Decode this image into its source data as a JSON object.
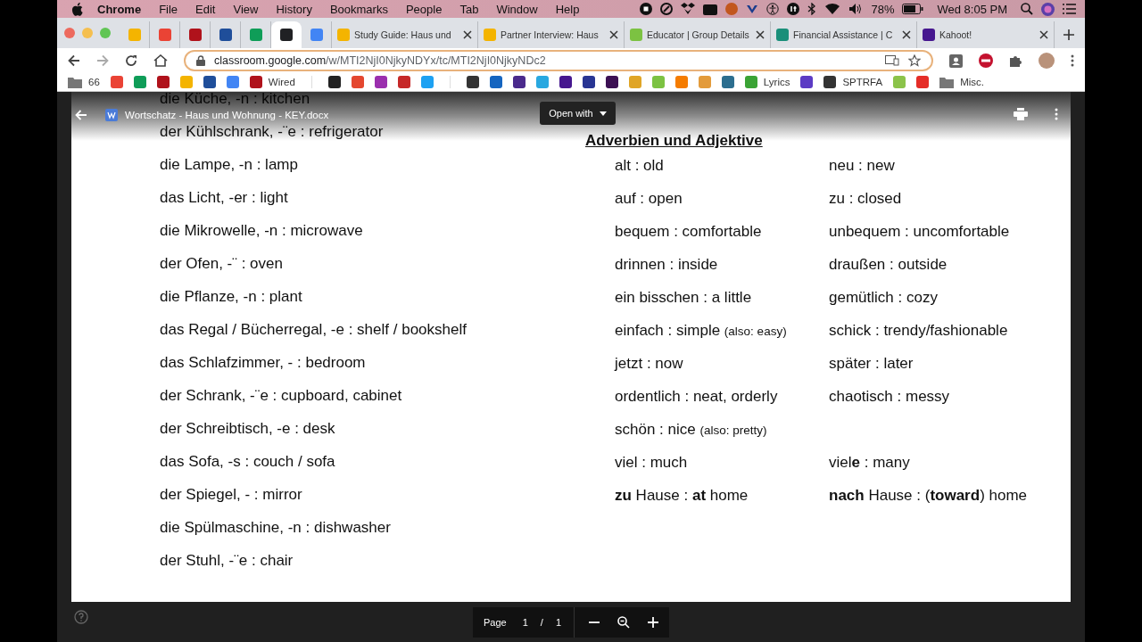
{
  "menu_bar": {
    "app": "Chrome",
    "items": [
      "File",
      "Edit",
      "View",
      "History",
      "Bookmarks",
      "People",
      "Tab",
      "Window",
      "Help"
    ],
    "battery": "78%",
    "clock": "Wed 8:05 PM"
  },
  "tabs": [
    {
      "kind": "pinned",
      "color": "#f4b400",
      "selected": false
    },
    {
      "kind": "pinned",
      "color": "#ea4335",
      "selected": false
    },
    {
      "kind": "pinned",
      "color": "#b0121b",
      "selected": false
    },
    {
      "kind": "pinned",
      "color": "#1f4e9a",
      "selected": false
    },
    {
      "kind": "pinned",
      "color": "#0f9d58",
      "selected": false
    },
    {
      "kind": "pinned",
      "color": "#202124",
      "selected": true
    },
    {
      "kind": "pinned",
      "color": "#4285f4",
      "selected": false
    },
    {
      "kind": "titled",
      "color": "#f4b400",
      "title": "Study Guide: Haus und",
      "selected": false
    },
    {
      "kind": "titled",
      "color": "#f4b400",
      "title": "Partner Interview: Haus",
      "selected": false
    },
    {
      "kind": "titled",
      "color": "#7cc242",
      "title": "Educator | Group Details",
      "selected": false
    },
    {
      "kind": "titled",
      "color": "#1a8f7a",
      "title": "Financial Assistance | C",
      "selected": false
    },
    {
      "kind": "titled",
      "color": "#46178f",
      "title": "Kahoot!",
      "selected": false
    }
  ],
  "address_bar": {
    "host": "classroom.google.com",
    "path": "/w/MTI2NjI0NjkyNDYx/tc/MTI2NjI0NjkyNDc2"
  },
  "bookmarks": [
    {
      "kind": "folder",
      "label": "66"
    },
    {
      "kind": "site",
      "color": "#ea4335"
    },
    {
      "kind": "site",
      "color": "#0f9d58"
    },
    {
      "kind": "site",
      "color": "#b0121b"
    },
    {
      "kind": "site",
      "color": "#f4b400"
    },
    {
      "kind": "site",
      "color": "#1f4e9a"
    },
    {
      "kind": "site",
      "color": "#4285f4"
    },
    {
      "kind": "site",
      "color": "#b0121b",
      "label": "Wired"
    },
    {
      "kind": "separator"
    },
    {
      "kind": "site",
      "color": "#222222"
    },
    {
      "kind": "site",
      "color": "#e4472f"
    },
    {
      "kind": "site",
      "color": "#9b2fae"
    },
    {
      "kind": "site",
      "color": "#c62828"
    },
    {
      "kind": "site",
      "color": "#1da1f2"
    },
    {
      "kind": "separator"
    },
    {
      "kind": "site",
      "color": "#333333"
    },
    {
      "kind": "site",
      "color": "#1565c0"
    },
    {
      "kind": "site",
      "color": "#4a2a8c"
    },
    {
      "kind": "site",
      "color": "#29a8e0"
    },
    {
      "kind": "site",
      "color": "#46178f"
    },
    {
      "kind": "site",
      "color": "#283593"
    },
    {
      "kind": "site",
      "color": "#3c1053"
    },
    {
      "kind": "site",
      "color": "#e0a526"
    },
    {
      "kind": "site",
      "color": "#7cc242"
    },
    {
      "kind": "site",
      "color": "#f57c00"
    },
    {
      "kind": "site",
      "color": "#e39b3b"
    },
    {
      "kind": "site",
      "color": "#2c6e8f"
    },
    {
      "kind": "site",
      "color": "#3aa335",
      "label": "Lyrics"
    },
    {
      "kind": "site",
      "color": "#5c3bc4"
    },
    {
      "kind": "site",
      "color": "#333333",
      "label": "SPTRFA"
    },
    {
      "kind": "site",
      "color": "#8bc34a"
    },
    {
      "kind": "site",
      "color": "#e52d27"
    },
    {
      "kind": "folder",
      "label": "Misc."
    }
  ],
  "viewer": {
    "file_name": "Wortschatz - Haus und Wohnung - KEY.docx",
    "open_with": "Open with"
  },
  "document": {
    "nouns": [
      "die Küche, -n : kitchen",
      "der Kühlschrank, -¨e : refrigerator",
      "die Lampe, -n : lamp",
      "das Licht, -er : light",
      "die Mikrowelle, -n : microwave",
      "der Ofen, -¨ : oven",
      "die Pflanze, -n : plant",
      "das Regal / Bücherregal, -e : shelf / bookshelf",
      "das Schlafzimmer, - : bedroom",
      "der Schrank, -¨e : cupboard, cabinet",
      "der Schreibtisch, -e : desk",
      "das Sofa, -s : couch / sofa",
      "der Spiegel, - : mirror",
      "die Spülmaschine, -n : dishwasher",
      "der Stuhl, -¨e : chair"
    ],
    "heading": "Adverbien und Adjektive",
    "pairs": [
      {
        "left": {
          "text": "alt : old"
        },
        "right": {
          "text": "neu : new"
        }
      },
      {
        "left": {
          "text": "auf : open"
        },
        "right": {
          "text": "zu : closed"
        }
      },
      {
        "left": {
          "text": "bequem : comfortable"
        },
        "right": {
          "text": "unbequem : uncomfortable"
        }
      },
      {
        "left": {
          "text": "drinnen : inside"
        },
        "right": {
          "text": "draußen : outside"
        }
      },
      {
        "left": {
          "text": "ein bisschen : a little"
        },
        "right": {
          "text": "gemütlich : cozy"
        }
      },
      {
        "left": {
          "text": "einfach : simple",
          "note": "(also: easy)"
        },
        "right": {
          "text": "schick : trendy/fashionable"
        }
      },
      {
        "left": {
          "text": "jetzt : now"
        },
        "right": {
          "text": "später : later"
        }
      },
      {
        "left": {
          "text": "ordentlich : neat, orderly"
        },
        "right": {
          "text": "chaotisch : messy"
        }
      },
      {
        "left": {
          "text": "schön : nice",
          "note": "(also: pretty)"
        }
      },
      {
        "left": {
          "text": "viel : much"
        },
        "right": {
          "text": "viel**e** : many"
        }
      },
      {
        "left": {
          "text": "**zu** Hause : **at** home"
        },
        "right": {
          "text": "**nach** Hause : (**toward**) home"
        }
      }
    ]
  },
  "page_controls": {
    "label": "Page",
    "current": "1",
    "separator": "/",
    "total": "1"
  }
}
